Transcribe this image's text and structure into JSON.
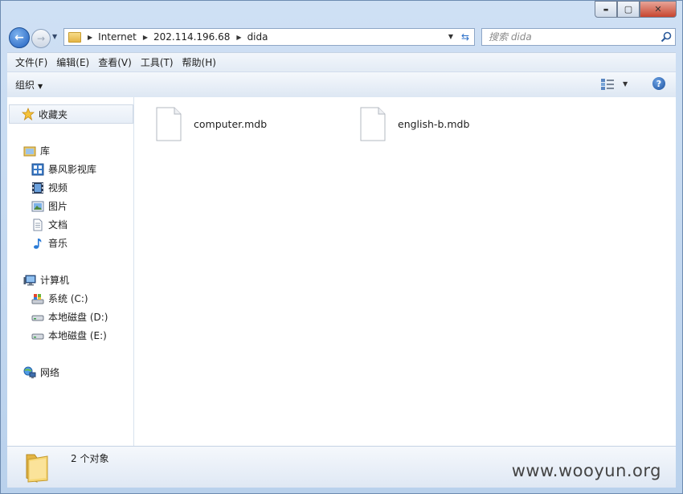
{
  "window": {
    "controls": {
      "minimize": "▬",
      "maximize": "▢",
      "close": "✕"
    }
  },
  "address_bar": {
    "breadcrumbs": [
      "Internet",
      "202.114.196.68",
      "dida"
    ],
    "search_placeholder": "搜索 dida"
  },
  "menu": [
    "文件(F)",
    "编辑(E)",
    "查看(V)",
    "工具(T)",
    "帮助(H)"
  ],
  "toolbar": {
    "organize": "组织"
  },
  "navigation": {
    "favorites": "收藏夹",
    "libraries": {
      "label": "库",
      "items": [
        "暴风影视库",
        "视频",
        "图片",
        "文档",
        "音乐"
      ]
    },
    "computer": {
      "label": "计算机",
      "items": [
        "系统 (C:)",
        "本地磁盘 (D:)",
        "本地磁盘 (E:)"
      ]
    },
    "network": "网络"
  },
  "files": [
    {
      "name": "computer.mdb"
    },
    {
      "name": "english-b.mdb"
    }
  ],
  "status": {
    "item_count": "2 个对象"
  },
  "watermark": "www.wooyun.org"
}
